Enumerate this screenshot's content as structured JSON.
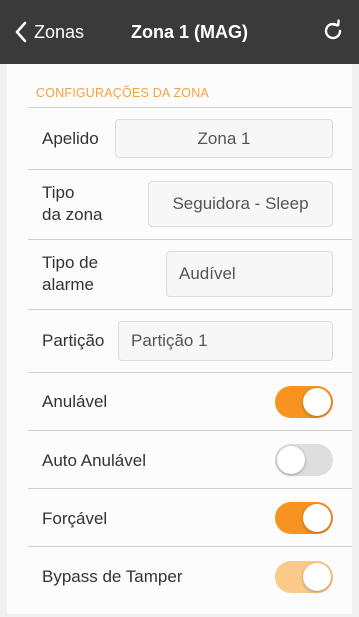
{
  "nav": {
    "back_label": "Zonas",
    "title": "Zona 1 (MAG)",
    "back_icon": "chevron-left-icon",
    "refresh_icon": "refresh-icon"
  },
  "section": {
    "header": "CONFIGURAÇÕES DA ZONA"
  },
  "fields": {
    "apelido": {
      "label": "Apelido",
      "value": "Zona 1"
    },
    "tipo_zona": {
      "label_line1": "Tipo",
      "label_line2": "da zona",
      "value": "Seguidora - Sleep"
    },
    "tipo_alarme": {
      "label_line1": "Tipo de",
      "label_line2": "alarme",
      "value": "Audível"
    },
    "particao": {
      "label": "Partição",
      "value": "Partição 1"
    }
  },
  "toggles": {
    "anulavel": {
      "label": "Anulável",
      "state": "on"
    },
    "auto_anulavel": {
      "label": "Auto Anulável",
      "state": "off"
    },
    "forcavel": {
      "label": "Forçável",
      "state": "on"
    },
    "bypass_tamper": {
      "label": "Bypass de Tamper",
      "state": "on-disabled"
    }
  },
  "colors": {
    "accent": "#f7931e",
    "accent_disabled": "#fbc989",
    "toggle_off": "#dedede",
    "navbar": "#3a3a3a",
    "section_header": "#f5a142"
  }
}
